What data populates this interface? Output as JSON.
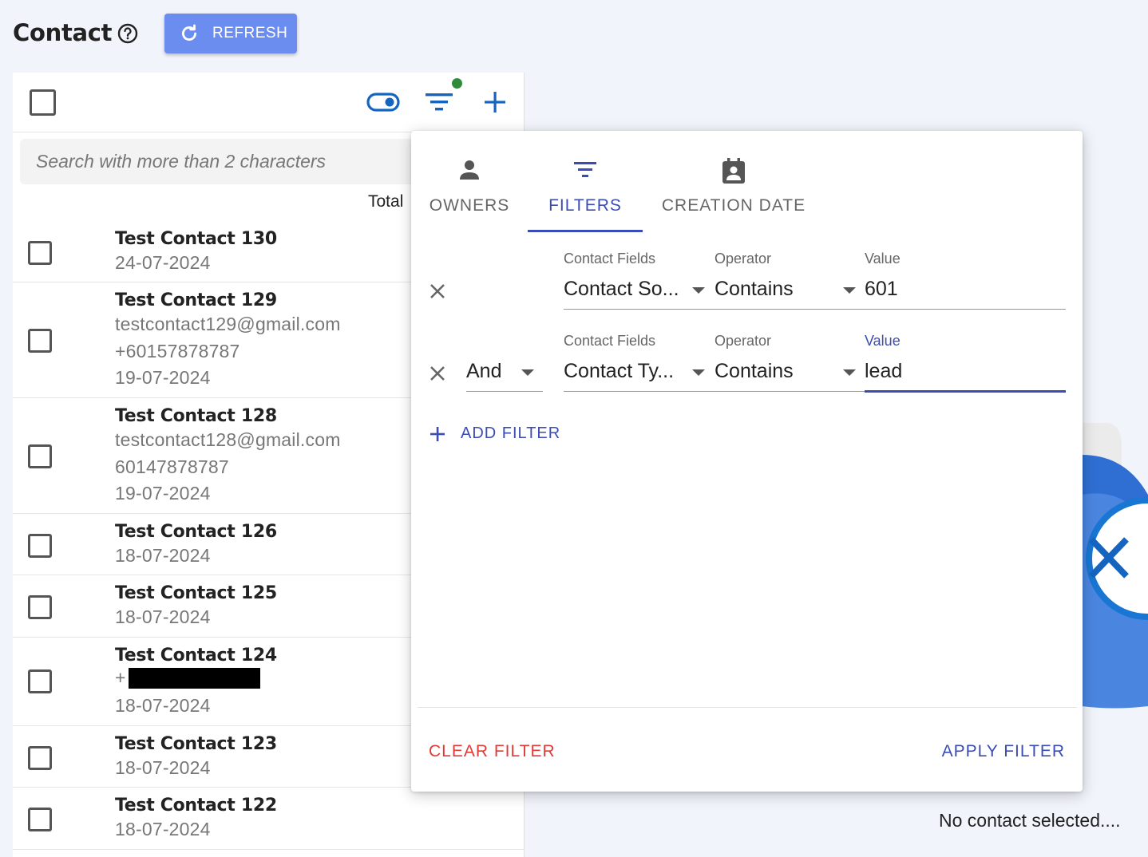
{
  "header": {
    "title": "Contact",
    "refresh_label": "REFRESH"
  },
  "search": {
    "placeholder": "Search with more than 2 characters",
    "total_label": "Total"
  },
  "contacts": [
    {
      "name": "Test Contact 130",
      "lines": [
        "24-07-2024"
      ]
    },
    {
      "name": "Test Contact 129",
      "lines": [
        "testcontact129@gmail.com",
        "+60157878787",
        "19-07-2024"
      ]
    },
    {
      "name": "Test Contact 128",
      "lines": [
        "testcontact128@gmail.com",
        "60147878787",
        "19-07-2024"
      ]
    },
    {
      "name": "Test Contact 126",
      "lines": [
        "18-07-2024"
      ]
    },
    {
      "name": "Test Contact 125",
      "lines": [
        "18-07-2024"
      ]
    },
    {
      "name": "Test Contact 124",
      "lines": [
        "+",
        "18-07-2024"
      ]
    },
    {
      "name": "Test Contact 123",
      "lines": [
        "18-07-2024"
      ]
    },
    {
      "name": "Test Contact 122",
      "lines": [
        "18-07-2024"
      ]
    }
  ],
  "filter_popover": {
    "tabs": [
      {
        "label": "OWNERS",
        "icon": "person-icon"
      },
      {
        "label": "FILTERS",
        "icon": "filter-icon",
        "active": true
      },
      {
        "label": "CREATION DATE",
        "icon": "contact-calendar-icon"
      }
    ],
    "rows": [
      {
        "connector": "",
        "field_label": "Contact Fields",
        "field_value": "Contact So...",
        "operator_label": "Operator",
        "operator_value": "Contains",
        "value_label": "Value",
        "value": "601"
      },
      {
        "connector": "And",
        "field_label": "Contact Fields",
        "field_value": "Contact Ty...",
        "operator_label": "Operator",
        "operator_value": "Contains",
        "value_label": "Value",
        "value": "lead"
      }
    ],
    "add_filter_label": "ADD FILTER",
    "clear_filter_label": "CLEAR FILTER",
    "apply_filter_label": "APPLY FILTER"
  },
  "detail": {
    "empty_text": "No contact selected...."
  },
  "colors": {
    "accent": "#3a4cb5",
    "refresh_button": "#6b8df0",
    "danger": "#e53935",
    "filter_active_dot": "#2e8b3a"
  }
}
